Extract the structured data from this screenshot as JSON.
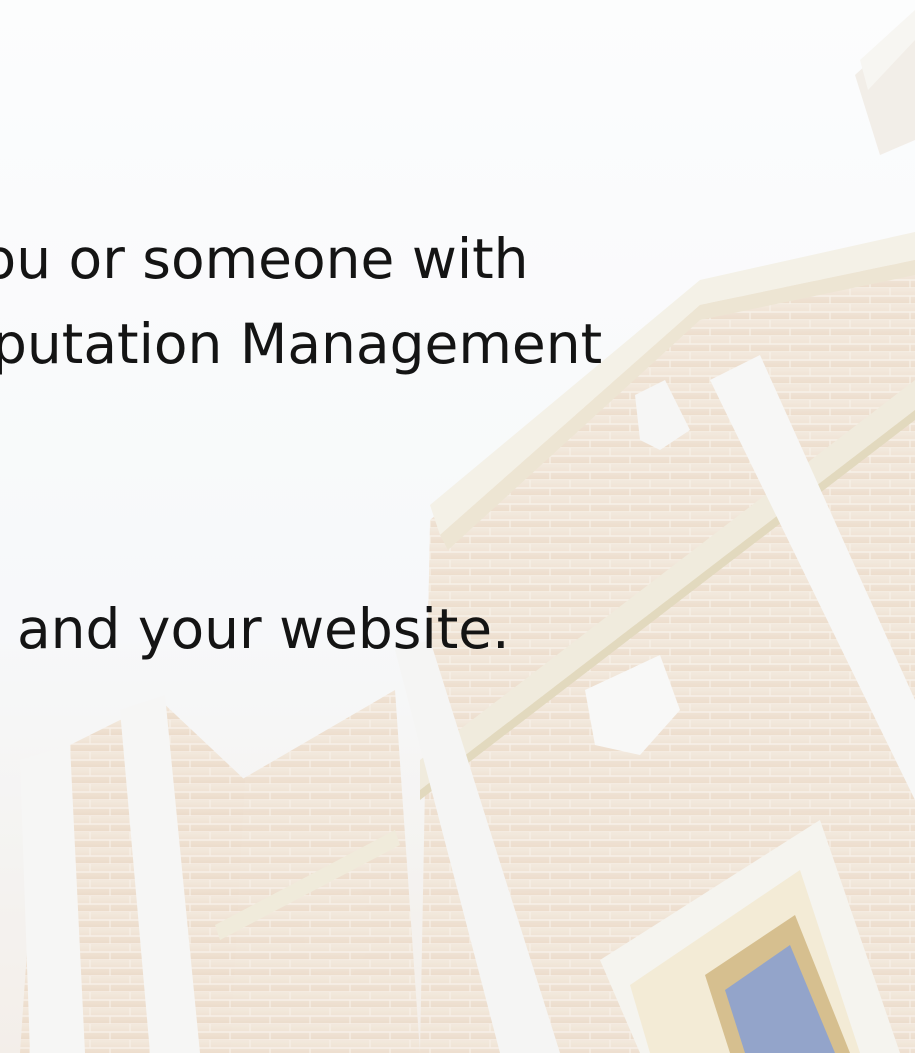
{
  "slide": {
    "lines": [
      "you or someone with",
      "putation Management",
      ". and your website."
    ]
  }
}
